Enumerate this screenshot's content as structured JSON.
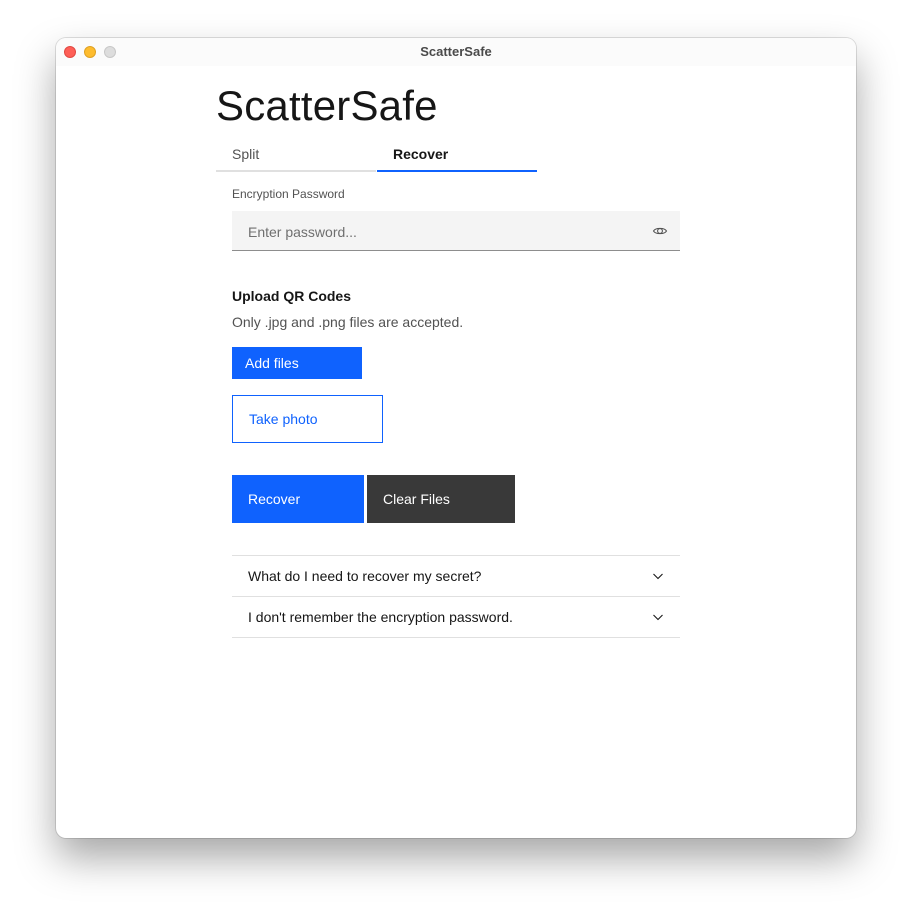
{
  "window": {
    "title": "ScatterSafe",
    "controls": [
      "close",
      "minimize",
      "maximize"
    ]
  },
  "app": {
    "title": "ScatterSafe"
  },
  "tabs": [
    {
      "label": "Split",
      "active": false
    },
    {
      "label": "Recover",
      "active": true
    }
  ],
  "password": {
    "label": "Encryption Password",
    "placeholder": "Enter password...",
    "value": "",
    "toggle_icon": "eye-icon"
  },
  "upload": {
    "title": "Upload QR Codes",
    "helper": "Only .jpg and .png files are accepted.",
    "add_files_label": "Add files",
    "take_photo_label": "Take photo"
  },
  "actions": {
    "recover_label": "Recover",
    "clear_label": "Clear Files"
  },
  "faq": [
    {
      "title": "What do I need to recover my secret?",
      "icon": "chevron-down-icon"
    },
    {
      "title": "I don't remember the encryption password.",
      "icon": "chevron-down-icon"
    }
  ],
  "colors": {
    "primary": "#0f62fe",
    "secondary": "#393939",
    "field_bg": "#f4f4f4",
    "text": "#161616"
  }
}
